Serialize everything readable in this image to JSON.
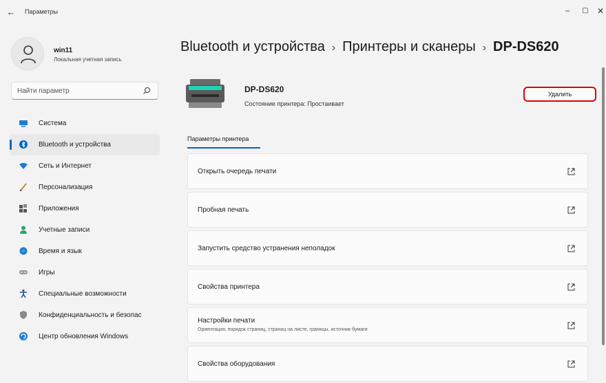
{
  "window": {
    "title": "Параметры"
  },
  "user": {
    "name": "win11",
    "subtitle": "Локальная учетная запись"
  },
  "search": {
    "placeholder": "Найти параметр"
  },
  "sidebar": {
    "items": [
      {
        "label": "Система",
        "icon": "system-icon",
        "color": "#1f7ad4"
      },
      {
        "label": "Bluetooth и устройства",
        "icon": "bluetooth-icon",
        "color": "#0067c0",
        "active": true
      },
      {
        "label": "Сеть и Интернет",
        "icon": "wifi-icon",
        "color": "#1f7ad4"
      },
      {
        "label": "Персонализация",
        "icon": "brush-icon",
        "color": "#d08a2a"
      },
      {
        "label": "Приложения",
        "icon": "apps-icon",
        "color": "#555"
      },
      {
        "label": "Учетные записи",
        "icon": "account-icon",
        "color": "#2ea36a"
      },
      {
        "label": "Время и язык",
        "icon": "time-language-icon",
        "color": "#1f7ad4"
      },
      {
        "label": "Игры",
        "icon": "gaming-icon",
        "color": "#888"
      },
      {
        "label": "Специальные возможности",
        "icon": "accessibility-icon",
        "color": "#1a4aa0"
      },
      {
        "label": "Конфиденциальность и безопас",
        "icon": "shield-icon",
        "color": "#777"
      },
      {
        "label": "Центр обновления Windows",
        "icon": "update-icon",
        "color": "#1f7ad4"
      }
    ]
  },
  "breadcrumb": {
    "items": [
      "Bluetooth и устройства",
      "Принтеры и сканеры"
    ],
    "current": "DP-DS620",
    "separator": "›"
  },
  "printer": {
    "name": "DP-DS620",
    "status": "Состояние принтера:  Простаивает",
    "delete_label": "Удалить"
  },
  "tabs": {
    "active": "Параметры принтера"
  },
  "cards": [
    {
      "title": "Открыть очередь печати",
      "subtitle": ""
    },
    {
      "title": "Пробная печать",
      "subtitle": ""
    },
    {
      "title": "Запустить средство устранения неполадок",
      "subtitle": ""
    },
    {
      "title": "Свойства принтера",
      "subtitle": ""
    },
    {
      "title": "Настройки печати",
      "subtitle": "Ориентация, порядок страниц, страниц на листе, границы, источник бумаги"
    },
    {
      "title": "Свойства оборудования",
      "subtitle": ""
    }
  ],
  "colors": {
    "accent": "#0067c0",
    "highlight": "#e00000"
  }
}
